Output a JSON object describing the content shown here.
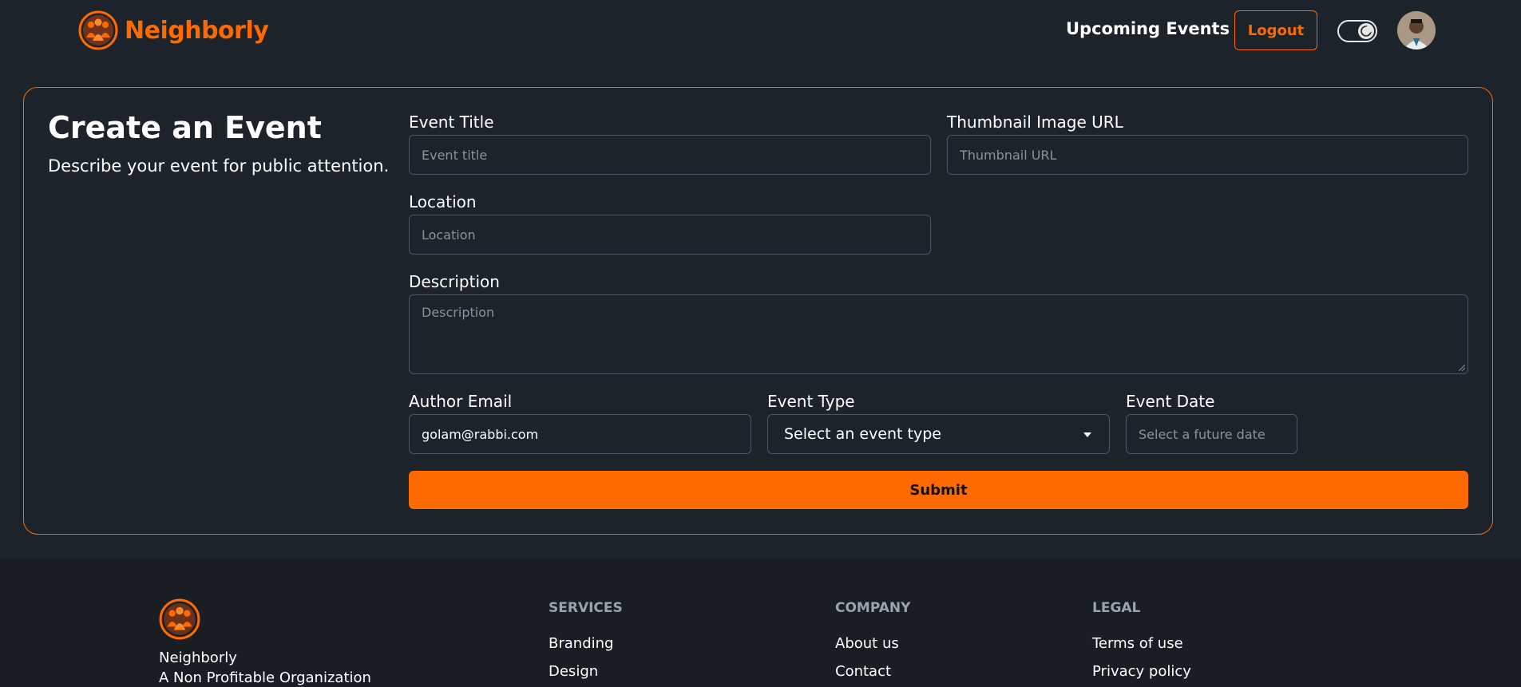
{
  "brand": {
    "name": "Neighborly",
    "accent_color": "#ff6a00",
    "logo_icon": "community-logo-icon"
  },
  "nav": {
    "upcoming_events": "Upcoming Events",
    "logout": "Logout",
    "theme_toggle_icon": "moon-icon",
    "avatar_icon": "user-avatar"
  },
  "form": {
    "title": "Create an Event",
    "subtitle": "Describe your event for public attention.",
    "fields": {
      "event_title": {
        "label": "Event Title",
        "placeholder": "Event title",
        "value": ""
      },
      "thumbnail": {
        "label": "Thumbnail Image URL",
        "placeholder": "Thumbnail URL",
        "value": ""
      },
      "location": {
        "label": "Location",
        "placeholder": "Location",
        "value": ""
      },
      "description": {
        "label": "Description",
        "placeholder": "Description",
        "value": ""
      },
      "author_email": {
        "label": "Author Email",
        "value": "golam@rabbi.com"
      },
      "event_type": {
        "label": "Event Type",
        "selected": "Select an event type"
      },
      "event_date": {
        "label": "Event Date",
        "placeholder": "Select a future date",
        "value": ""
      }
    },
    "submit": "Submit"
  },
  "footer": {
    "brand_name": "Neighborly",
    "tagline": "A Non Profitable Organization",
    "services": {
      "heading": "SERVICES",
      "links": [
        "Branding",
        "Design"
      ]
    },
    "company": {
      "heading": "COMPANY",
      "links": [
        "About us",
        "Contact"
      ]
    },
    "legal": {
      "heading": "LEGAL",
      "links": [
        "Terms of use",
        "Privacy policy"
      ]
    }
  }
}
